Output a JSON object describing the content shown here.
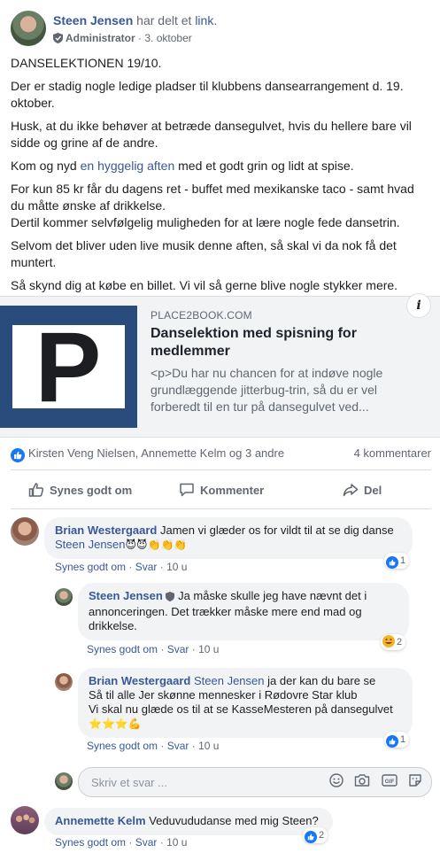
{
  "post": {
    "author": "Steen Jensen",
    "action_text": "har delt et",
    "action_link": "link.",
    "role": "Administrator",
    "date": "3. oktober",
    "paragraphs": {
      "p1": "DANSELEKTIONEN 19/10.",
      "p2": "Der er stadig nogle ledige pladser til klubbens dansearrangement d. 19. oktober.",
      "p3": "Husk, at du ikke behøver at betræde dansegulvet, hvis du hellere bare vil sidde og grine af de andre.",
      "p4_before": "Kom og nyd",
      "p4_link": "en hyggelig aften",
      "p4_after": "med et godt grin og lidt at spise.",
      "p5_line1": "For kun 85 kr får du dagens ret - buffet med mexikanske taco - samt hvad du måtte ønske af drikkelse.",
      "p5_line2": "Dertil kommer selvfølgelig muligheden for at lære nogle fede dansetrin.",
      "p6": "Selvom det bliver uden live musik denne aften, så skal vi da nok få det muntert.",
      "p7": "Så skynd dig at købe en billet. Vi vil så gerne blive nogle stykker mere."
    }
  },
  "link_card": {
    "domain": "PLACE2BOOK.COM",
    "title": "Danselektion med spisning for medlemmer",
    "description": "<p>Du har nu chancen for at indøve nogle grundlæggende jitterbug-trin, så du er vel forberedt til en tur på dansegulvet ved...",
    "logo_letter": "P",
    "info_label": "i"
  },
  "reactions": {
    "names": "Kirsten Veng Nielsen, Annemette Kelm og 3 andre",
    "comments_count": "4 kommentarer"
  },
  "actions": {
    "like": "Synes godt om",
    "comment": "Kommenter",
    "share": "Del"
  },
  "comments": [
    {
      "name": "Brian Westergaard",
      "text": "Jamen vi glæder os for vildt til at se dig danse",
      "mention": "Steen Jensen",
      "emojis": "😈😈👏👏👏",
      "like": "Synes godt om",
      "reply": "Svar",
      "time": "10 u",
      "reaction_count": "1"
    },
    {
      "name": "Steen Jensen",
      "text": "Ja måske skulle jeg have nævnt det i annonceringen. Det trækker måske mere end mad og drikkelse.",
      "like": "Synes godt om",
      "reply": "Svar",
      "time": "10 u",
      "reaction_count": "2"
    },
    {
      "name": "Brian Westergaard",
      "mention": "Steen Jensen",
      "line1": "ja der kan du bare se",
      "line2": "Så til alle Jer skønne mennesker i Rødovre Star klub",
      "line3": "Vi skal nu glæde os til at se KasseMesteren på dansegulvet",
      "emojis": "⭐⭐⭐💪",
      "like": "Synes godt om",
      "reply": "Svar",
      "time": "10 u",
      "reaction_count": "1"
    },
    {
      "name": "Annemette Kelm",
      "text": "Veduvududanse med mig Steen?",
      "like": "Synes godt om",
      "reply": "Svar",
      "time": "10 u",
      "reaction_count": "2"
    }
  ],
  "reply_box": {
    "placeholder": "Skriv et svar ..."
  },
  "colors": {
    "link_blue": "#385898",
    "text": "#1c1e21",
    "muted": "#606770",
    "like_blue": "#1877f2",
    "bubble_bg": "#f2f3f5",
    "logo_navy": "#2a4c7d"
  }
}
